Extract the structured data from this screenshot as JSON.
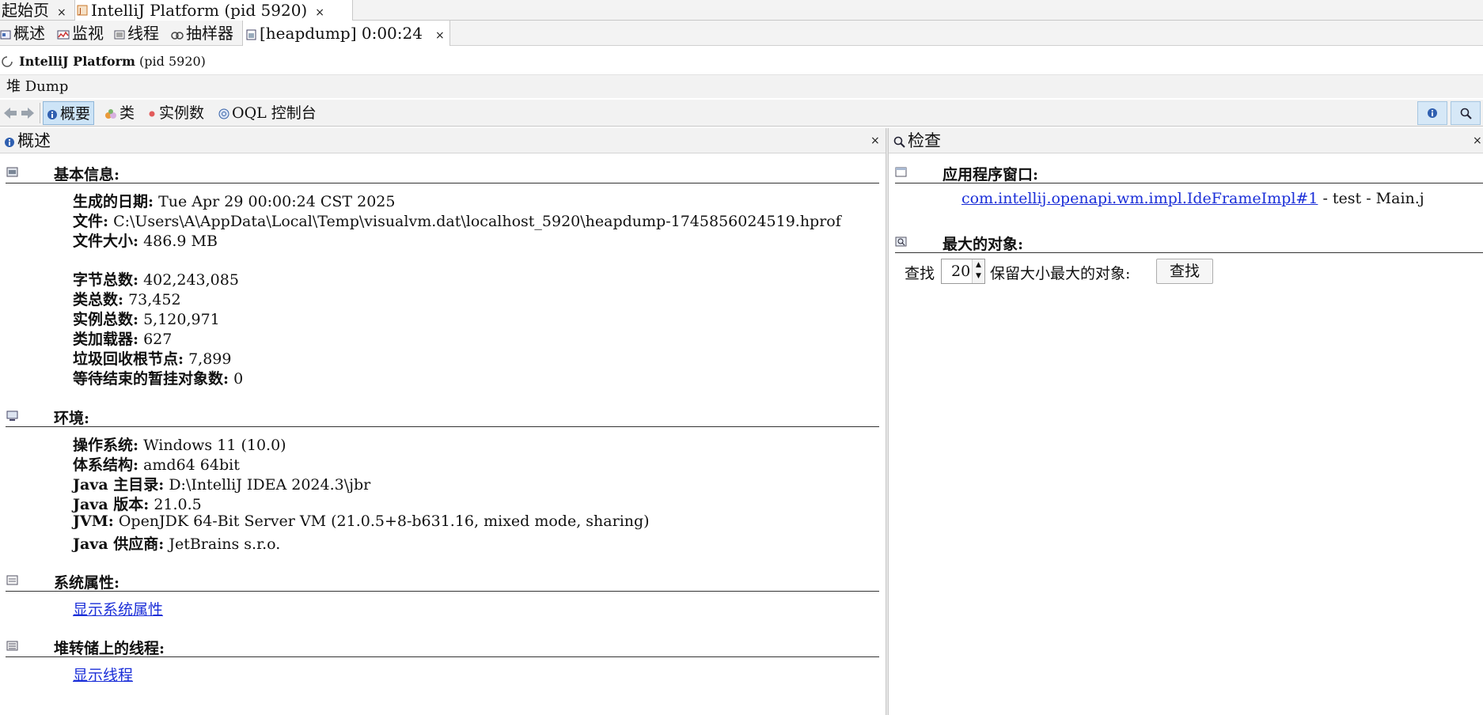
{
  "window_tabs": [
    {
      "label": "起始页",
      "close": "×"
    },
    {
      "label": "IntelliJ Platform (pid 5920)",
      "close": "×"
    }
  ],
  "sub_tabs": [
    {
      "label": "概述"
    },
    {
      "label": "监视"
    },
    {
      "label": "线程"
    },
    {
      "label": "抽样器"
    },
    {
      "label": "[heapdump] 0:00:24",
      "close": "×"
    }
  ],
  "process": {
    "name": "IntelliJ Platform",
    "pid": "(pid 5920)"
  },
  "heap_dump_label": "堆 Dump",
  "view_toolbar": {
    "items": [
      "概要",
      "类",
      "实例数",
      "OQL 控制台"
    ]
  },
  "left_panel": {
    "title": "概述",
    "close": "×",
    "basic": {
      "title": "基本信息:",
      "rows": [
        {
          "label": "生成的日期:",
          "value": "Tue Apr 29 00:00:24 CST 2025"
        },
        {
          "label": "文件:",
          "value": "C:\\Users\\A\\AppData\\Local\\Temp\\visualvm.dat\\localhost_5920\\heapdump-1745856024519.hprof"
        },
        {
          "label": "文件大小:",
          "value": "486.9 MB"
        }
      ],
      "stats": [
        {
          "label": "字节总数:",
          "value": "402,243,085"
        },
        {
          "label": "类总数:",
          "value": "73,452"
        },
        {
          "label": "实例总数:",
          "value": "5,120,971"
        },
        {
          "label": "类加载器:",
          "value": "627"
        },
        {
          "label": "垃圾回收根节点:",
          "value": "7,899"
        },
        {
          "label": "等待结束的暂挂对象数:",
          "value": "0"
        }
      ]
    },
    "env": {
      "title": "环境:",
      "rows": [
        {
          "label": "操作系统:",
          "value": "Windows 11 (10.0)"
        },
        {
          "label": "体系结构:",
          "value": "amd64 64bit"
        },
        {
          "label": "Java 主目录:",
          "value": "D:\\IntelliJ IDEA 2024.3\\jbr"
        },
        {
          "label": "Java 版本:",
          "value": "21.0.5"
        },
        {
          "label": "JVM:",
          "value": "OpenJDK 64-Bit Server VM (21.0.5+8-b631.16, mixed mode, sharing)"
        },
        {
          "label": "Java 供应商:",
          "value": "JetBrains s.r.o."
        }
      ]
    },
    "sysprops": {
      "title": "系统属性:",
      "link": "显示系统属性"
    },
    "threads": {
      "title": "堆转储上的线程:",
      "link": "显示线程"
    }
  },
  "right_panel": {
    "title": "检查",
    "close": "×",
    "app_window": {
      "title": "应用程序窗口:",
      "link": "com.intellij.openapi.wm.impl.IdeFrameImpl#1",
      "suffix": " - test - Main.j"
    },
    "biggest": {
      "title": "最大的对象:",
      "prefix": "查找",
      "count": "20",
      "suffix": "保留大小最大的对象:",
      "button": "查找"
    }
  }
}
